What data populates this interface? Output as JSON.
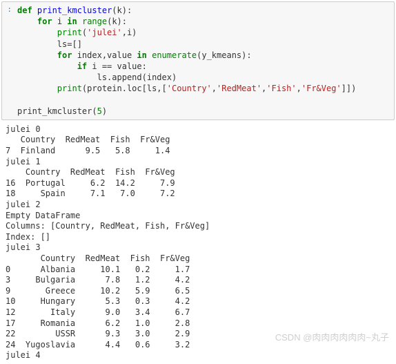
{
  "prompt": ":",
  "code": {
    "l1_def": "def",
    "l1_name": "print_kmcluster",
    "l1_rest": "(k):",
    "l2_for": "for",
    "l2_var": " i ",
    "l2_in": "in",
    "l2_range": "range",
    "l2_rest": "(k):",
    "l3_print": "print",
    "l3_arg1": "'julei'",
    "l3_rest": ",i)",
    "l4": "ls=[]",
    "l5_for": "for",
    "l5_mid": " index,value ",
    "l5_in": "in",
    "l5_enum": "enumerate",
    "l5_rest": "(y_kmeans):",
    "l6_if": "if",
    "l6_rest": " i == value:",
    "l7": "ls.append(index)",
    "l8_print": "print",
    "l8_a": "(protein.loc[ls,[",
    "l8_s1": "'Country'",
    "l8_s2": "'RedMeat'",
    "l8_s3": "'Fish'",
    "l8_s4": "'Fr&Veg'",
    "l8_b": "]])",
    "l10_call": "print_kmcluster(",
    "l10_num": "5",
    "l10_end": ")"
  },
  "output": {
    "lines": [
      "julei 0",
      "   Country  RedMeat  Fish  Fr&Veg",
      "7  Finland      9.5   5.8     1.4",
      "julei 1",
      "    Country  RedMeat  Fish  Fr&Veg",
      "16  Portugal     6.2  14.2     7.9",
      "18     Spain     7.1   7.0     7.2",
      "julei 2",
      "Empty DataFrame",
      "Columns: [Country, RedMeat, Fish, Fr&Veg]",
      "Index: []",
      "julei 3",
      "       Country  RedMeat  Fish  Fr&Veg",
      "0      Albania     10.1   0.2     1.7",
      "3     Bulgaria      7.8   1.2     4.2",
      "9       Greece     10.2   5.9     6.5",
      "10     Hungary      5.3   0.3     4.2",
      "12       Italy      9.0   3.4     6.7",
      "17     Romania      6.2   1.0     2.8",
      "22        USSR      9.3   3.0     2.9",
      "24  Yugoslavia      4.4   0.6     3.2",
      "julei 4"
    ]
  },
  "watermark": "CSDN @肉肉肉肉肉肉~丸子"
}
